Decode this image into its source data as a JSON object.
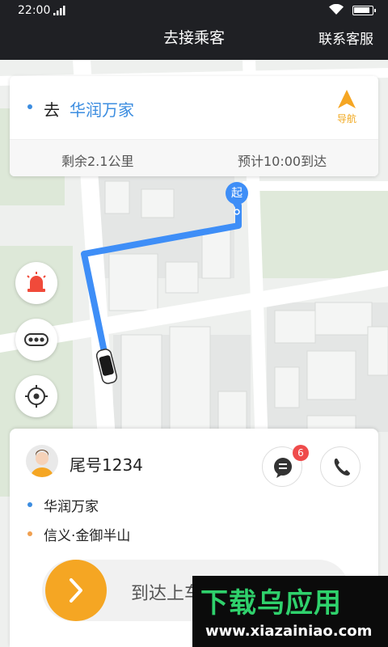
{
  "status_bar": {
    "time": "22:00"
  },
  "header": {
    "title": "去接乘客",
    "service_label": "联系客服"
  },
  "destination": {
    "prefix": "去",
    "name": "华润万家",
    "nav_label": "导航",
    "remaining": "剩余2.1公里",
    "eta": "预计10:00到达"
  },
  "map": {
    "start_label": "起"
  },
  "passenger": {
    "tail_number": "尾号1234",
    "message_badge": "6",
    "pickup": "华润万家",
    "dropoff": "信义·金御半山"
  },
  "slider": {
    "label": "到达上车点"
  },
  "watermark": {
    "title": "下载乌应用",
    "url": "www.xiazainiao.com"
  },
  "colors": {
    "accent_blue": "#3c8de0",
    "accent_orange": "#f5a623",
    "pickup_dot": "#3c8de0",
    "dropoff_dot": "#f0a050",
    "badge_red": "#ef4b4b",
    "alarm_red": "#f04a3a"
  },
  "icons": {
    "signal": "signal-icon",
    "wifi": "wifi-icon",
    "battery": "battery-icon",
    "navigation": "navigation-arrow-icon",
    "alarm": "alarm-light-icon",
    "more": "more-dots-icon",
    "locate": "locate-icon",
    "message": "message-icon",
    "phone": "phone-icon",
    "arrow": "chevron-right-icon"
  },
  "battery_level": 0.9
}
